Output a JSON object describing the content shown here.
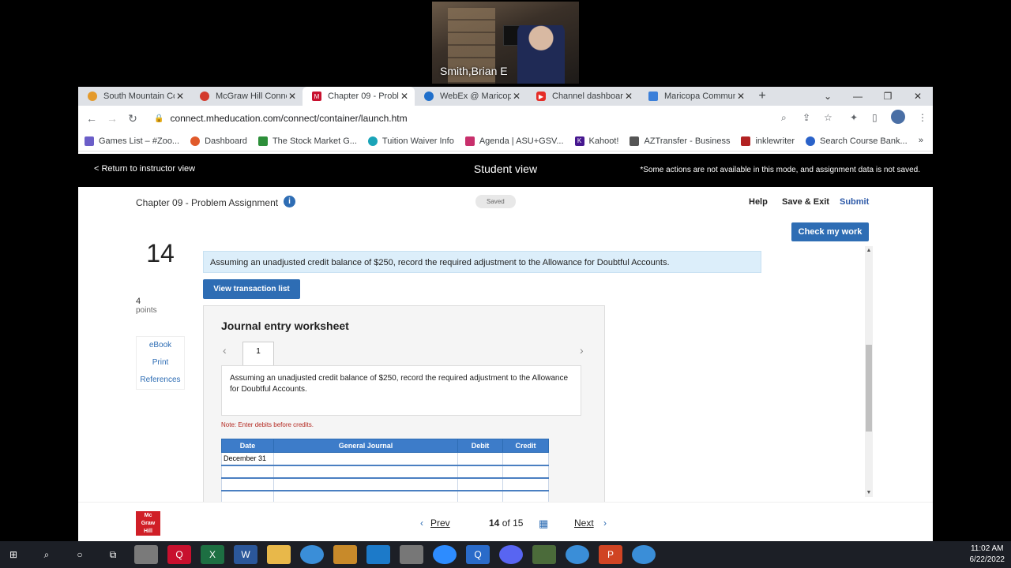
{
  "video": {
    "name": "Smith,Brian E"
  },
  "tabs": [
    {
      "title": "South Mountain Co",
      "color": "#e49a2b"
    },
    {
      "title": "McGraw Hill Conne",
      "color": "#d33a2c"
    },
    {
      "title": "Chapter 09 - Probl",
      "color": "#c8102e"
    },
    {
      "title": "WebEx @ Maricopa",
      "color": "#1f6fcb"
    },
    {
      "title": "Channel dashboard",
      "color": "#e52d27"
    },
    {
      "title": "Maricopa Commun",
      "color": "#3b7fd9"
    }
  ],
  "address": {
    "url": "connect.mheducation.com/connect/container/launch.htm"
  },
  "bookmarks": [
    {
      "label": "Games List – #Zoo...",
      "color": "#6b5ec8"
    },
    {
      "label": "Dashboard",
      "color": "#e05a2b"
    },
    {
      "label": "The Stock Market G...",
      "color": "#2d8f3a"
    },
    {
      "label": "Tuition Waiver Info",
      "color": "#1aa4b8"
    },
    {
      "label": "Agenda | ASU+GSV...",
      "color": "#c8306c"
    },
    {
      "label": "Kahoot!",
      "color": "#46178f"
    },
    {
      "label": "AZTransfer - Business",
      "color": "#555555"
    },
    {
      "label": "inklewriter",
      "color": "#b22222"
    },
    {
      "label": "Search Course Bank...",
      "color": "#2a62c9"
    }
  ],
  "student_bar": {
    "back": "< Return to instructor view",
    "title": "Student view",
    "note": "*Some actions are not available in this mode, and assignment data is not saved."
  },
  "assignment": {
    "title": "Chapter 09 - Problem Assignment",
    "saved": "Saved",
    "help": "Help",
    "save_exit": "Save & Exit",
    "submit": "Submit",
    "check_work": "Check my work"
  },
  "question": {
    "number": "14",
    "points": "4",
    "points_label": "points",
    "resources": [
      "eBook",
      "Print",
      "References"
    ],
    "banner": "Assuming an unadjusted credit balance of $250, record the required adjustment to the Allowance for Doubtful Accounts.",
    "view_tx": "View transaction list"
  },
  "worksheet": {
    "title": "Journal entry worksheet",
    "tab": "1",
    "description": "Assuming an unadjusted credit balance of $250, record the required adjustment to the Allowance for Doubtful Accounts.",
    "note": "Note: Enter debits before credits.",
    "columns": [
      "Date",
      "General Journal",
      "Debit",
      "Credit"
    ],
    "rows": [
      [
        "December 31",
        "",
        "",
        ""
      ],
      [
        "",
        "",
        "",
        ""
      ],
      [
        "",
        "",
        "",
        ""
      ],
      [
        "",
        "",
        "",
        ""
      ]
    ]
  },
  "footer": {
    "prev": "Prev",
    "current": "14",
    "of": "of",
    "total": "15",
    "next": "Next"
  },
  "clock": {
    "time": "11:02 AM",
    "date": "6/22/2022"
  }
}
